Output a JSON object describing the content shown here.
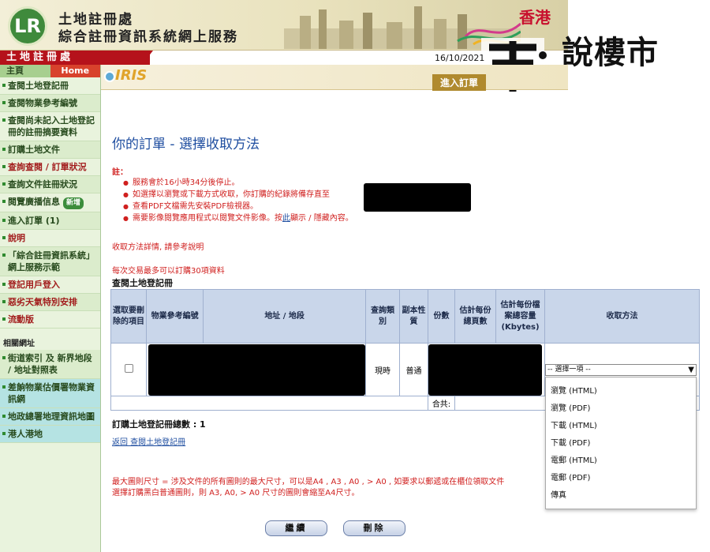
{
  "header": {
    "org_name": "土地註冊處",
    "org_subtitle": "綜合註冊資訊系統網上服務",
    "logo_text": "LR",
    "hk_label": "香港",
    "watermark_text": "說樓市",
    "department_bar": "土地註冊處",
    "date": "16/10/2021",
    "iris_logo": "IRIS",
    "order_entry": "進入訂單"
  },
  "sidebar": {
    "tab_main": "主頁",
    "tab_home": "Home",
    "items": [
      {
        "label": "查閱土地登記冊"
      },
      {
        "label": "查閱物業參考編號"
      },
      {
        "label": "查閱尚未記入土地登記冊的註冊摘要資料"
      },
      {
        "label": "訂購土地文件"
      },
      {
        "label": "查詢查閱 / 訂單狀況"
      },
      {
        "label": "查詢文件註冊狀況"
      },
      {
        "label": "閱覽廣播信息",
        "badge": "新增"
      },
      {
        "label": "進入訂單 (1)"
      },
      {
        "label": "說明"
      },
      {
        "label": "「綜合註冊資訊系統」網上服務示範"
      },
      {
        "label": "登記用戶登入"
      },
      {
        "label": "惡劣天氣特別安排"
      },
      {
        "label": "流動版"
      }
    ],
    "related_title": "相關網址",
    "related": [
      {
        "label": "街道索引 及 新界地段 / 地址對照表"
      },
      {
        "label": "差餉物業估價署物業資訊網"
      },
      {
        "label": "地政總署地理資訊地圖"
      },
      {
        "label": "港人港地"
      }
    ]
  },
  "main": {
    "title": "你的訂單 - 選擇收取方法",
    "note_label": "註：",
    "notes": [
      "服務會於16小時34分後停止。",
      "如選擇以瀏覽或下載方式收取，你訂購的紀錄將備存直至",
      "查看PDF文檔需先安裝PDF檢視器。",
      "需要影像閱覽應用程式以閱覽文件影像。按",
      "此",
      "顯示 / 隱藏內容。"
    ],
    "method_info": "收取方法詳情, 請參考說明",
    "limit": "每次交易最多可以訂購30項資料",
    "section_head": "查閱土地登記冊",
    "table": {
      "headers": [
        "選取要刪除的項目",
        "物業參考編號",
        "地址 / 地段",
        "查詢類別",
        "副本性質",
        "份數",
        "估計每份總頁數",
        "估計每份檔案總容量 (Kbytes)",
        "收取方法"
      ],
      "row": {
        "type": "現時",
        "nature": "普通"
      },
      "total_label": "合共:"
    },
    "select_value": "-- 選擇一項 --",
    "select_options": [
      "瀏覽 (HTML)",
      "瀏覽 (PDF)",
      "下載 (HTML)",
      "下載 (PDF)",
      "電郵 (HTML)",
      "電郵 (PDF)",
      "傳真"
    ],
    "total_count": "訂購土地登記冊總數 : 1",
    "back_link": "返回 查閱土地登記冊",
    "max_size_1": "最大圖則尺寸 = 涉及文件的所有圖則的最大尺寸，可以是A4 , A3 , A0 , > A0 , 如要求以郵遞或在櫃位領取文件",
    "max_size_2": "選擇訂購黑白普通圖則，則 A3, A0, > A0 尺寸的圖則會縮至A4尺寸。",
    "btn_continue": "繼續",
    "btn_delete": "刪除"
  }
}
